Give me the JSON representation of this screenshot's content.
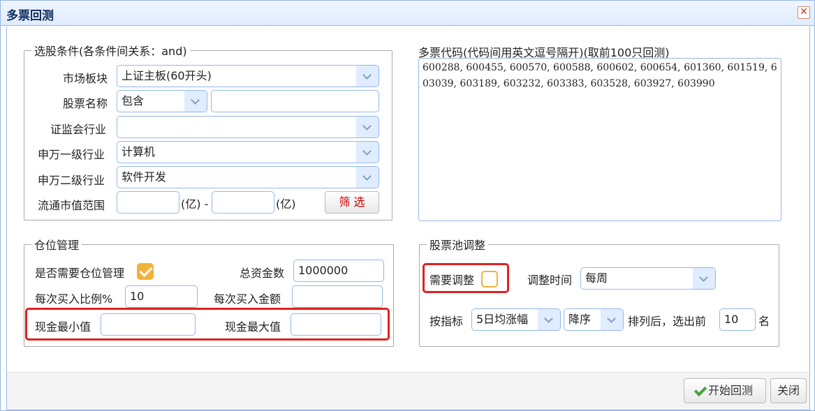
{
  "window": {
    "title": "多票回测",
    "close_glyph": "✕"
  },
  "stock_filter": {
    "legend": "选股条件(各条件间关系：and)",
    "market_label": "市场板块",
    "market_value": "上证主板(60开头)",
    "name_label": "股票名称",
    "name_mode": "包含",
    "name_value": "",
    "csrc_label": "证监会行业",
    "csrc_value": "",
    "sw1_label": "申万一级行业",
    "sw1_value": "计算机",
    "sw2_label": "申万二级行业",
    "sw2_value": "软件开发",
    "cap_label": "流通市值范围",
    "cap_min": "",
    "cap_unit1": "(亿) -",
    "cap_max": "",
    "cap_unit2": "(亿)",
    "filter_button": "筛 选"
  },
  "codes": {
    "label": "多票代码(代码间用英文逗号隔开)(取前100只回测)",
    "value": "600288, 600455, 600570, 600588, 600602, 600654, 601360, 601519, 603039, 603189, 603232, 603383, 603528, 603927, 603990"
  },
  "position": {
    "legend": "仓位管理",
    "need_label": "是否需要仓位管理",
    "need_checked": true,
    "total_label": "总资金数",
    "total_value": "1000000",
    "ratio_label": "每次买入比例%",
    "ratio_value": "10",
    "amount_label": "每次买入金额",
    "amount_value": "",
    "cash_min_label": "现金最小值",
    "cash_min_value": "",
    "cash_max_label": "现金最大值",
    "cash_max_value": ""
  },
  "pool": {
    "legend": "股票池调整",
    "adjust_label": "需要调整",
    "adjust_checked": false,
    "time_label": "调整时间",
    "time_value": "每周",
    "by_label": "按指标",
    "indicator_value": "5日均涨幅",
    "order_value": "降序",
    "after_label": "排列后，选出前",
    "top_n": "10",
    "unit": "名"
  },
  "footer": {
    "start_button": "开始回测",
    "close_button": "关闭"
  },
  "colors": {
    "accent_border": "#95b8e7",
    "checkbox": "#f3b13a",
    "highlight": "#e02020",
    "filter_text": "#cc0000",
    "start_icon": "#44a33b"
  }
}
